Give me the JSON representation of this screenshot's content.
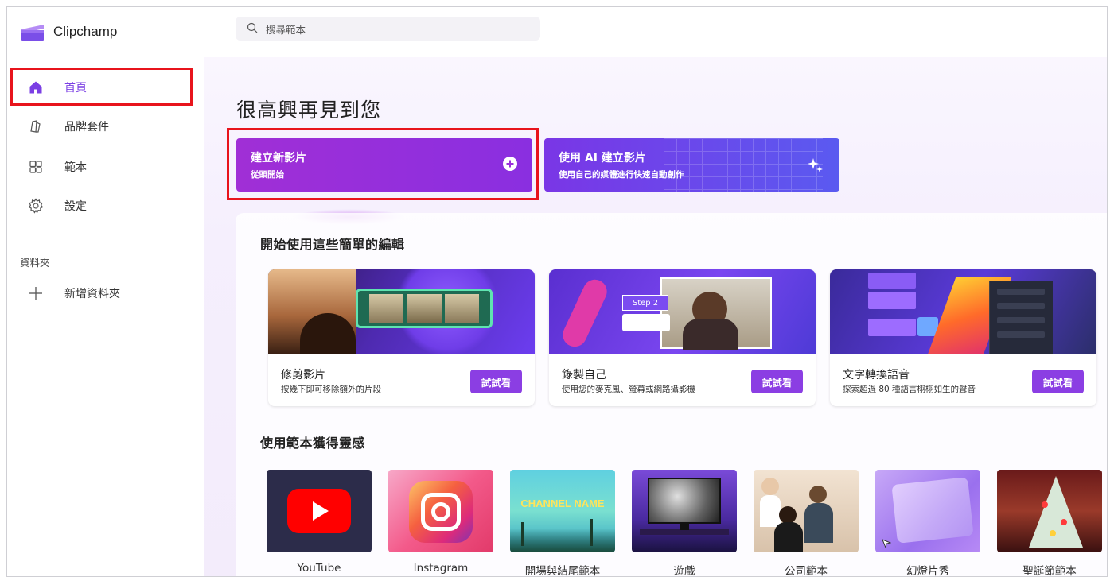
{
  "app": {
    "name": "Clipchamp"
  },
  "sidebar": {
    "items": [
      {
        "label": "首頁",
        "icon": "home-icon"
      },
      {
        "label": "品牌套件",
        "icon": "brand-kit-icon"
      },
      {
        "label": "範本",
        "icon": "templates-icon"
      },
      {
        "label": "設定",
        "icon": "gear-icon"
      }
    ],
    "folders_label": "資料夾",
    "new_folder_label": "新增資料夾"
  },
  "search": {
    "placeholder": "搜尋範本"
  },
  "main": {
    "greeting": "很高興再見到您",
    "cta_new": {
      "title": "建立新影片",
      "subtitle": "從頭開始"
    },
    "cta_ai": {
      "title": "使用 AI 建立影片",
      "subtitle": "使用自己的媒體進行快速自動創作"
    },
    "quick_edits_title": "開始使用這些簡單的編輯",
    "quick_edits": [
      {
        "title": "修剪影片",
        "desc": "按幾下即可移除額外的片段",
        "button": "試試看"
      },
      {
        "title": "錄製自己",
        "desc": "使用您的麥克風、螢幕或網路攝影機",
        "button": "試試看",
        "thumb_text": "Step 2"
      },
      {
        "title": "文字轉換語音",
        "desc": "探索超過 80 種語言栩栩如生的聲音",
        "button": "試試看"
      }
    ],
    "templates_title": "使用範本獲得靈感",
    "templates": [
      {
        "label": "YouTube"
      },
      {
        "label": "Instagram"
      },
      {
        "label": "開場與結尾範本",
        "thumb_text": "CHANNEL NAME"
      },
      {
        "label": "遊戲"
      },
      {
        "label": "公司範本"
      },
      {
        "label": "幻燈片秀"
      },
      {
        "label": "聖誕節範本"
      }
    ]
  },
  "colors": {
    "accent": "#7b3fe4",
    "highlight": "#e8141c",
    "button": "#8b3ee3"
  }
}
